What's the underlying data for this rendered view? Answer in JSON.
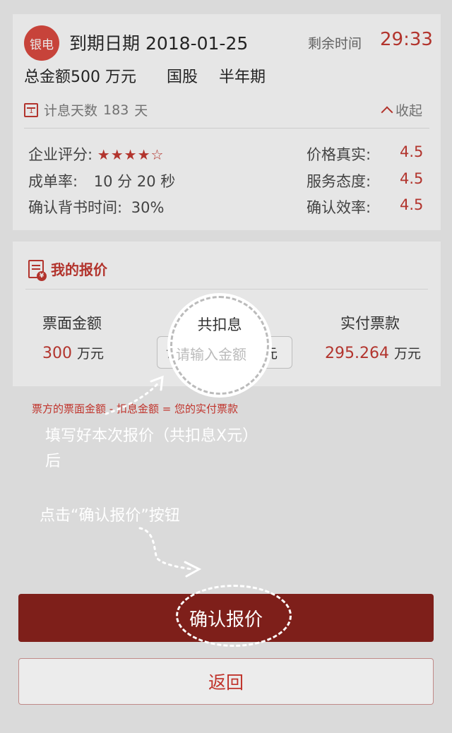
{
  "bill": {
    "bank_badge": "银电",
    "due_label": "到期日期",
    "due_date": "2018-01-25",
    "remain_label": "剩余时间",
    "remain_value": "29:33",
    "amount_label": "总金额",
    "amount_value": "500",
    "amount_unit": "万元",
    "tag1": "国股",
    "tag2": "半年期",
    "days_label": "计息天数",
    "days_value": "183",
    "days_unit": "天",
    "collapse_label": "收起"
  },
  "stats": {
    "rating_label": "企业评分:",
    "rating_stars": 4,
    "rating_max": 5,
    "rate_label": "成单率:",
    "rate_value": "10 分 20 秒",
    "endorse_label": "确认背书时间:",
    "endorse_value": "30%",
    "price_label": "价格真实:",
    "price_value": "4.5",
    "service_label": "服务态度:",
    "service_value": "4.5",
    "efficiency_label": "确认效率:",
    "efficiency_value": "4.5"
  },
  "quote": {
    "title": "我的报价",
    "face_header": "票面金额",
    "interest_header": "共扣息",
    "pay_header": "实付票款",
    "face_value": "300",
    "face_unit": "万元",
    "input_placeholder": "请输入金额",
    "input_unit": "元",
    "pay_value": "295.264",
    "pay_unit": "万元",
    "formula": "票方的票面金额 - 扣息金额 = 您的实付票款"
  },
  "guide": {
    "hint1": "填写好本次报价（共扣息X元）后",
    "hint2": "点击“确认报价”按钮"
  },
  "buttons": {
    "confirm": "确认报价",
    "back": "返回"
  },
  "colors": {
    "accent": "#c0342c",
    "confirm_bg": "#7e1f1a"
  }
}
